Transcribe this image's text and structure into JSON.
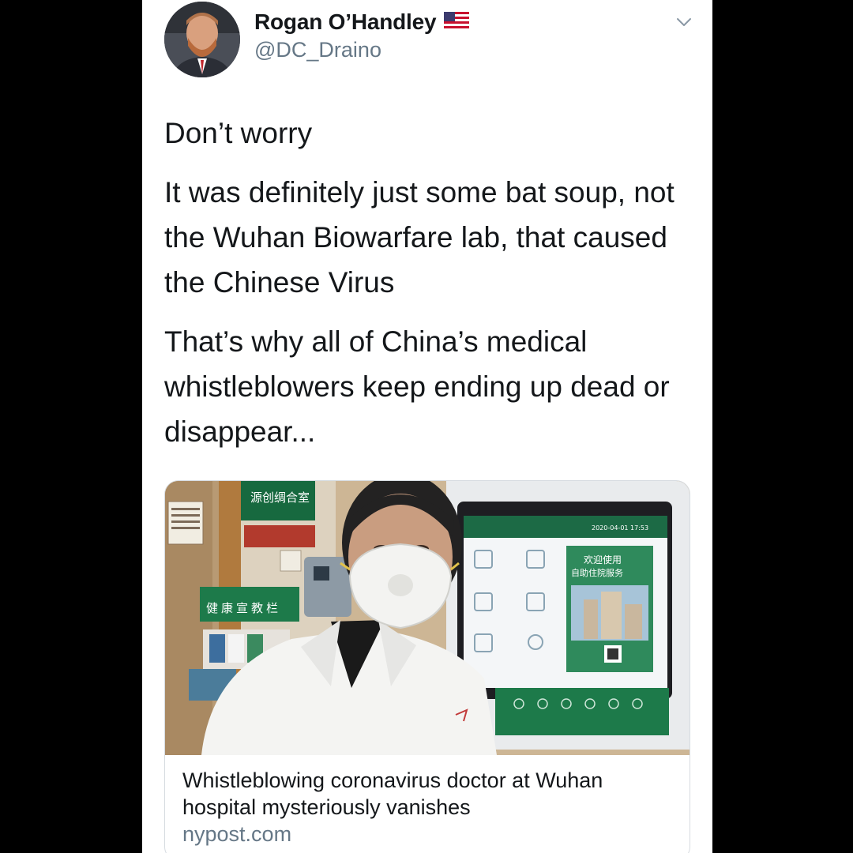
{
  "author": {
    "display_name": "Rogan O’Handley",
    "handle": "@DC_Draino",
    "flag_icon": "us-flag-icon",
    "avatar_icon": "avatar-photo"
  },
  "menu_icon": "chevron-down-icon",
  "tweet": {
    "paragraphs": [
      "Don’t worry",
      "It was definitely just some bat soup, not the Wuhan Biowarfare lab, that caused the Chinese Virus",
      "That’s why all of China’s medical whistleblowers keep ending up dead or disappear..."
    ]
  },
  "link_card": {
    "title": "Whistleblowing coronavirus doctor at Wuhan hospital mysteriously vanishes",
    "domain": "nypost.com",
    "image": {
      "sign_room": "源创绸合室",
      "sign_health": "健康宣教栏",
      "screen_date": "2020-04-01 17:53",
      "screen_welcome": "欢迎使用",
      "screen_service": "自助住院服务"
    }
  },
  "colors": {
    "text_primary": "#14171a",
    "text_secondary": "#657786",
    "border": "#d6dbe0"
  }
}
